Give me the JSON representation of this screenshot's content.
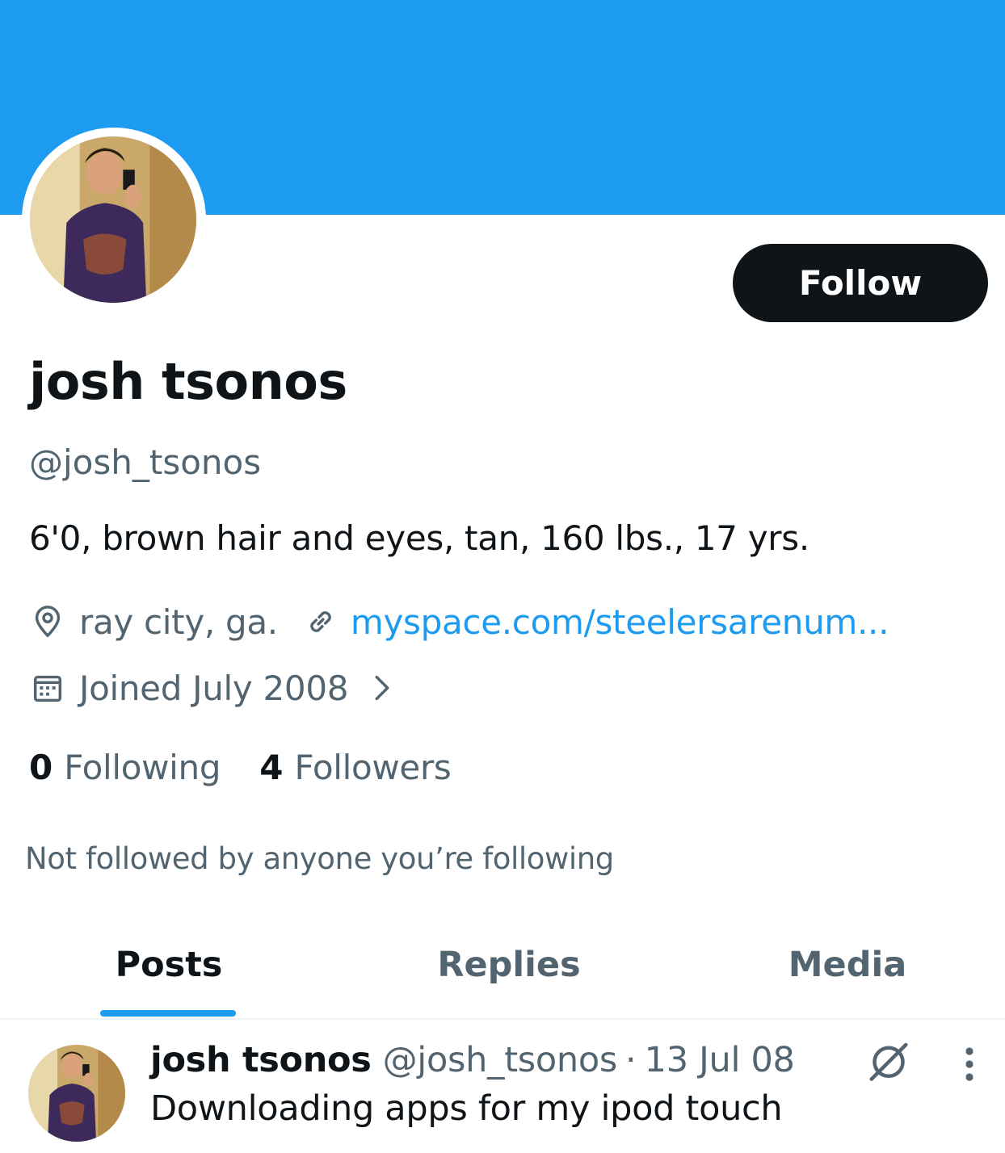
{
  "colors": {
    "banner": "#1d9bf0",
    "accent": "#1d9bf0",
    "text_primary": "#0f1419",
    "text_secondary": "#536471"
  },
  "profile": {
    "display_name": "josh tsonos",
    "handle": "@josh_tsonos",
    "bio": "6'0, brown hair and eyes, tan, 160 lbs., 17 yrs.",
    "location": "ray city, ga.",
    "website": "myspace.com/steelersarenum...",
    "joined": "Joined July 2008",
    "following_count": "0",
    "following_label": "Following",
    "followers_count": "4",
    "followers_label": "Followers",
    "not_followed_text": "Not followed by anyone you’re following"
  },
  "actions": {
    "follow_label": "Follow"
  },
  "icons": {
    "location": "location-pin-icon",
    "link": "link-icon",
    "calendar": "calendar-icon",
    "chevron": "chevron-right-icon",
    "grok": "grok-icon",
    "more": "more-vertical-icon"
  },
  "tabs": [
    {
      "label": "Posts",
      "active": true
    },
    {
      "label": "Replies",
      "active": false
    },
    {
      "label": "Media",
      "active": false
    }
  ],
  "posts": [
    {
      "name": "josh tsonos",
      "handle": "@josh_tsonos",
      "separator": "·",
      "date": "13 Jul 08",
      "text": "Downloading apps for my ipod touch"
    }
  ]
}
